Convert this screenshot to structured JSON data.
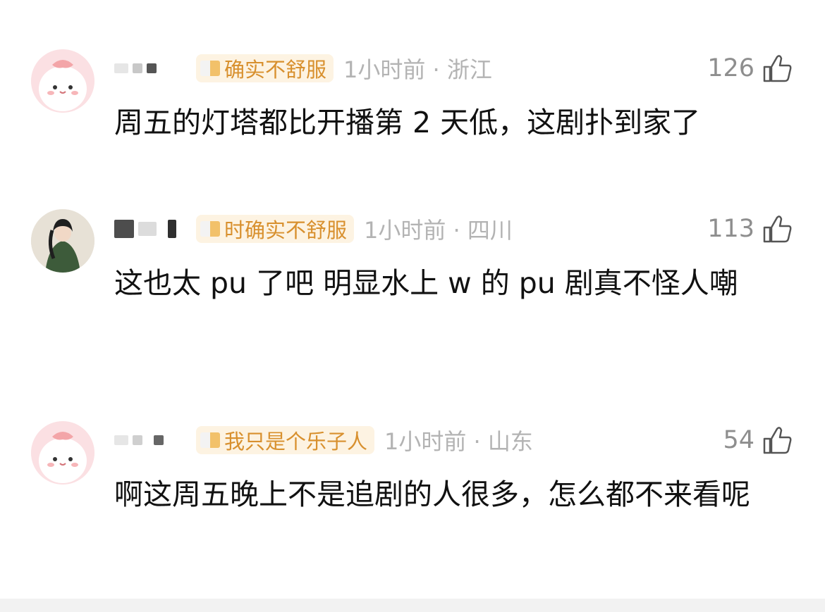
{
  "comments": [
    {
      "badge": "确实不舒服",
      "meta": "1小时前 · 浙江",
      "likes": "126",
      "text": "周五的灯塔都比开播第 2 天低，这剧扑到家了",
      "avatar": "pink-cartoon-avatar"
    },
    {
      "badge": "时确实不舒服",
      "meta": "1小时前 · 四川",
      "likes": "113",
      "text": "这也太 pu 了吧  明显水上 w 的 pu 剧真不怪人嘲",
      "avatar": "portrait-photo-avatar"
    },
    {
      "badge": "我只是个乐子人",
      "meta": "1小时前 · 山东",
      "likes": "54",
      "text": "啊这周五晚上不是追剧的人很多，怎么都不来看呢",
      "avatar": "pink-cartoon-avatar"
    }
  ],
  "icons": {
    "like": "thumbs-up-icon"
  },
  "colors": {
    "badge_text": "#d8902e",
    "badge_bg": "#fdf3e2",
    "meta": "#b3b3b3",
    "body_text": "#111111"
  }
}
